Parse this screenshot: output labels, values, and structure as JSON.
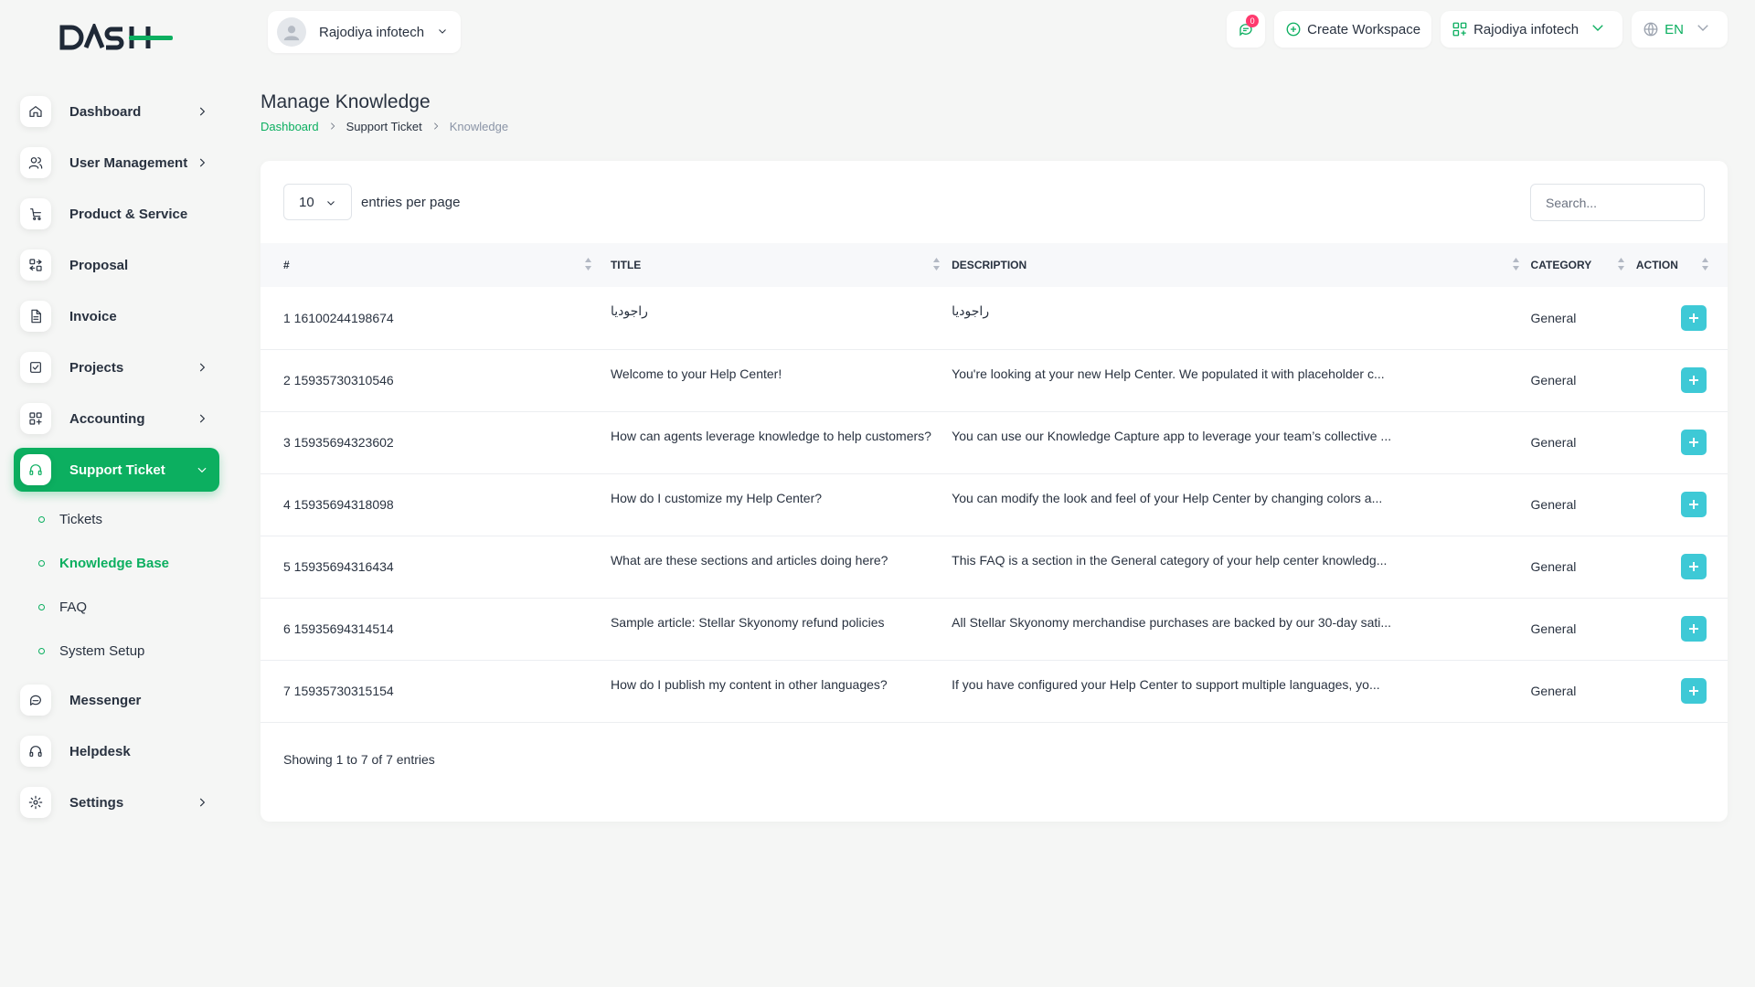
{
  "logo": {
    "text": "DASH"
  },
  "sidebar": {
    "items": [
      {
        "label": "Dashboard",
        "icon": "home-icon",
        "chevron": true
      },
      {
        "label": "User Management",
        "icon": "users-icon",
        "chevron": true
      },
      {
        "label": "Product & Service",
        "icon": "cart-icon",
        "chevron": false
      },
      {
        "label": "Proposal",
        "icon": "proposal-icon",
        "chevron": false
      },
      {
        "label": "Invoice",
        "icon": "file-icon",
        "chevron": false
      },
      {
        "label": "Projects",
        "icon": "checkbox-icon",
        "chevron": true
      },
      {
        "label": "Accounting",
        "icon": "grid-icon",
        "chevron": true
      },
      {
        "label": "Support Ticket",
        "icon": "headset-icon",
        "chevron": true,
        "active": true
      }
    ],
    "sub_items": [
      {
        "label": "Tickets"
      },
      {
        "label": "Knowledge Base",
        "active": true
      },
      {
        "label": "FAQ"
      },
      {
        "label": "System Setup"
      }
    ],
    "bottom_items": [
      {
        "label": "Messenger",
        "icon": "chat-icon"
      },
      {
        "label": "Helpdesk",
        "icon": "headset-icon"
      },
      {
        "label": "Settings",
        "icon": "gear-icon",
        "chevron": true
      }
    ]
  },
  "header": {
    "user_name": "Rajodiya infotech",
    "notification_count": "0",
    "create_workspace": "Create Workspace",
    "workspace_name": "Rajodiya infotech",
    "language": "EN"
  },
  "page": {
    "title": "Manage Knowledge",
    "breadcrumb": [
      "Dashboard",
      "Support Ticket",
      "Knowledge"
    ]
  },
  "table": {
    "entries_value": "10",
    "entries_label": "entries per page",
    "search_placeholder": "Search...",
    "columns": [
      "#",
      "TITLE",
      "DESCRIPTION",
      "CATEGORY",
      "ACTION"
    ],
    "rows": [
      {
        "num": "1 16100244198674",
        "title": "راجوديا",
        "description": "راجوديا",
        "category": "General",
        "rtl": true
      },
      {
        "num": "2 15935730310546",
        "title": "Welcome to your Help Center!",
        "description": "You're looking at your new Help Center. We populated it with placeholder c...",
        "category": "General"
      },
      {
        "num": "3 15935694323602",
        "title": "How can agents leverage knowledge to help customers?",
        "description": "You can use our Knowledge Capture app to leverage your team’s collective ...",
        "category": "General"
      },
      {
        "num": "4 15935694318098",
        "title": "How do I customize my Help Center?",
        "description": "You can modify the look and feel of your Help Center by changing colors a...",
        "category": "General"
      },
      {
        "num": "5 15935694316434",
        "title": "What are these sections and articles doing here?",
        "description": "This FAQ is a section in the General category of your help center knowledg...",
        "category": "General"
      },
      {
        "num": "6 15935694314514",
        "title": "Sample article: Stellar Skyonomy refund policies",
        "description": "All Stellar Skyonomy merchandise purchases are backed by our 30-day sati...",
        "category": "General"
      },
      {
        "num": "7 15935730315154",
        "title": "How do I publish my content in other languages?",
        "description": "If you have configured your Help Center to support multiple languages, yo...",
        "category": "General"
      }
    ],
    "footer": "Showing 1 to 7 of 7 entries"
  },
  "colors": {
    "accent": "#0caf60",
    "action": "#3ec9d6",
    "badge": "#ff3a6e"
  }
}
